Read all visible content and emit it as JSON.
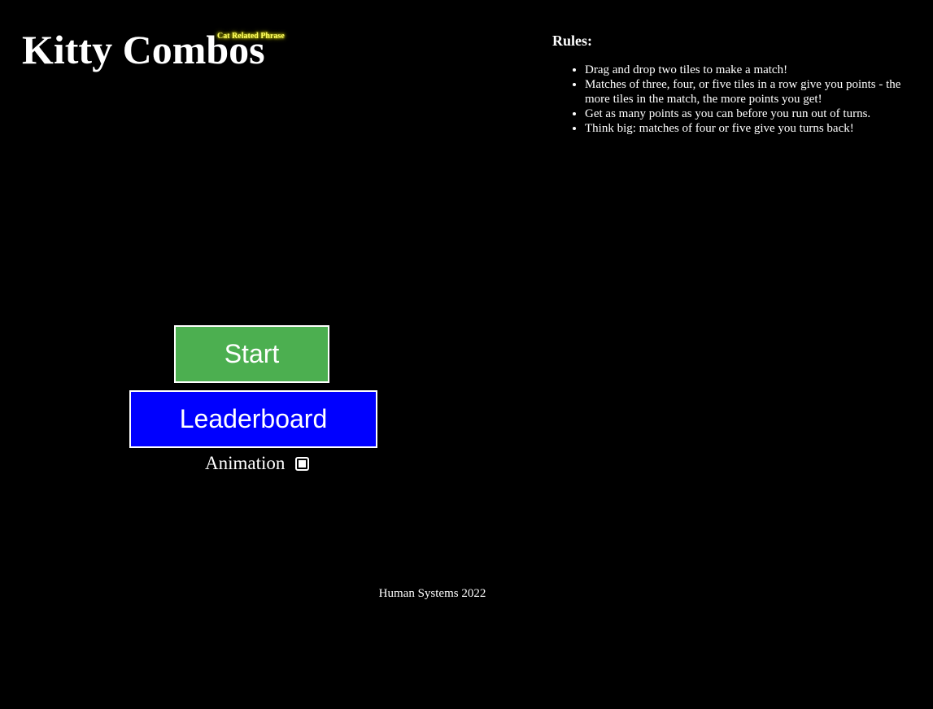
{
  "header": {
    "title": "Kitty Combos",
    "tagline": "Cat Related Phrase"
  },
  "rules": {
    "heading": "Rules:",
    "items": [
      "Drag and drop two tiles to make a match!",
      "Matches of three, four, or five tiles in a row give you points - the more tiles in the match, the more points you get!",
      "Get as many points as you can before you run out of turns.",
      "Think big: matches of four or five give you turns back!"
    ]
  },
  "menu": {
    "start_label": "Start",
    "leaderboard_label": "Leaderboard",
    "animation_label": "Animation",
    "animation_checked": true
  },
  "colors": {
    "background": "#000000",
    "start_button": "#4caf50",
    "leaderboard_button": "#0000ff",
    "tagline_glow": "#ffff00"
  },
  "footer": {
    "text": "Human Systems 2022"
  }
}
